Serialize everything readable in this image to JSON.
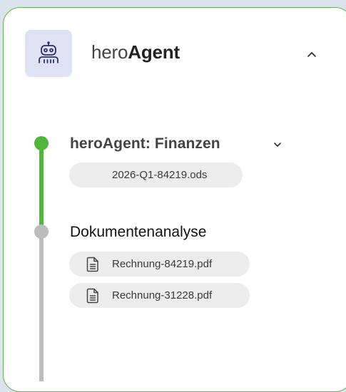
{
  "header": {
    "app_name_prefix": "hero",
    "app_name_suffix": "Agent",
    "logo_icon": "robot-icon",
    "collapse_icon": "chevron-up-icon"
  },
  "steps": [
    {
      "title": "heroAgent: Finanzen",
      "status": "complete",
      "expand_icon": "chevron-down-icon",
      "files": [
        {
          "name": "2026-Q1-84219.ods"
        }
      ]
    },
    {
      "title": "Dokumentenanalyse",
      "status": "pending",
      "files": [
        {
          "name": "Rechnung-84219.pdf",
          "icon": "document-icon"
        },
        {
          "name": "Rechnung-31228.pdf",
          "icon": "document-icon"
        }
      ]
    }
  ],
  "colors": {
    "accent_green": "#4fb83a",
    "pending_gray": "#bcbcbc",
    "logo_bg": "#dfe1f5",
    "chip_bg": "#ececec",
    "page_bg": "#dbe4ee"
  }
}
